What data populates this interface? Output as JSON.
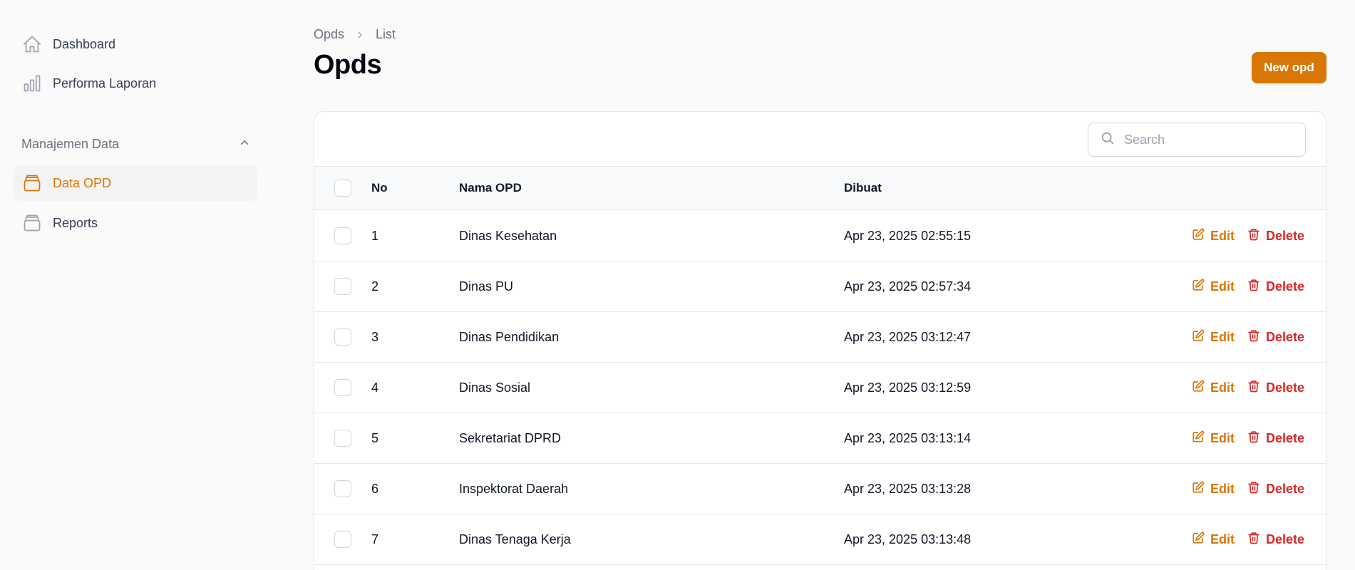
{
  "sidebar": {
    "items": [
      {
        "label": "Dashboard",
        "icon": "home-icon"
      },
      {
        "label": "Performa Laporan",
        "icon": "bar-chart-icon"
      }
    ],
    "group": {
      "label": "Manajemen Data",
      "items": [
        {
          "label": "Data OPD",
          "icon": "archive-box-icon",
          "active": true
        },
        {
          "label": "Reports",
          "icon": "archive-box-icon",
          "active": false
        }
      ]
    }
  },
  "breadcrumb": {
    "parent": "Opds",
    "current": "List"
  },
  "page": {
    "title": "Opds",
    "new_button": "New opd"
  },
  "search": {
    "placeholder": "Search"
  },
  "table": {
    "columns": {
      "no": "No",
      "nama": "Nama OPD",
      "dibuat": "Dibuat"
    },
    "action_labels": {
      "edit": "Edit",
      "delete": "Delete"
    },
    "rows": [
      {
        "no": "1",
        "nama": "Dinas Kesehatan",
        "dibuat": "Apr 23, 2025 02:55:15"
      },
      {
        "no": "2",
        "nama": "Dinas PU",
        "dibuat": "Apr 23, 2025 02:57:34"
      },
      {
        "no": "3",
        "nama": "Dinas Pendidikan",
        "dibuat": "Apr 23, 2025 03:12:47"
      },
      {
        "no": "4",
        "nama": "Dinas Sosial",
        "dibuat": "Apr 23, 2025 03:12:59"
      },
      {
        "no": "5",
        "nama": "Sekretariat DPRD",
        "dibuat": "Apr 23, 2025 03:13:14"
      },
      {
        "no": "6",
        "nama": "Inspektorat Daerah",
        "dibuat": "Apr 23, 2025 03:13:28"
      },
      {
        "no": "7",
        "nama": "Dinas Tenaga Kerja",
        "dibuat": "Apr 23, 2025 03:13:48"
      }
    ]
  },
  "colors": {
    "accent": "#d97706",
    "danger": "#dc2626"
  }
}
